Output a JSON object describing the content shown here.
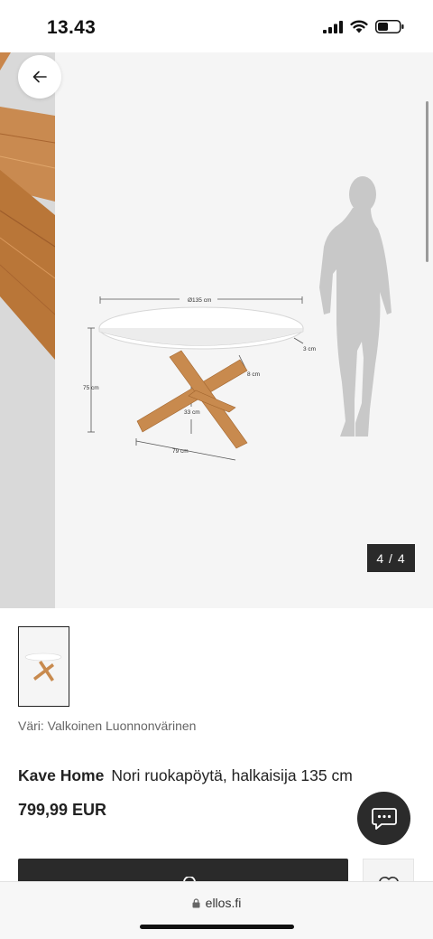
{
  "status": {
    "time": "13.43"
  },
  "gallery": {
    "counter": "4 / 4",
    "dimensions": {
      "diameter": "Ø135 cm",
      "height": "75 cm",
      "top_thickness": "3 cm",
      "leg_size": "8 cm",
      "leg_height": "33 cm",
      "base_width": "79 cm"
    }
  },
  "product": {
    "color_label": "Väri: Valkoinen Luonnonvärinen",
    "brand": "Kave Home",
    "name": "Nori ruokapöytä, halkaisija 135 cm",
    "price": "799,99 EUR"
  },
  "browser": {
    "url": "ellos.fi"
  },
  "colors": {
    "dark": "#2a2a2a",
    "wood": "#c98a4e",
    "silhouette": "#c9c9c9"
  }
}
